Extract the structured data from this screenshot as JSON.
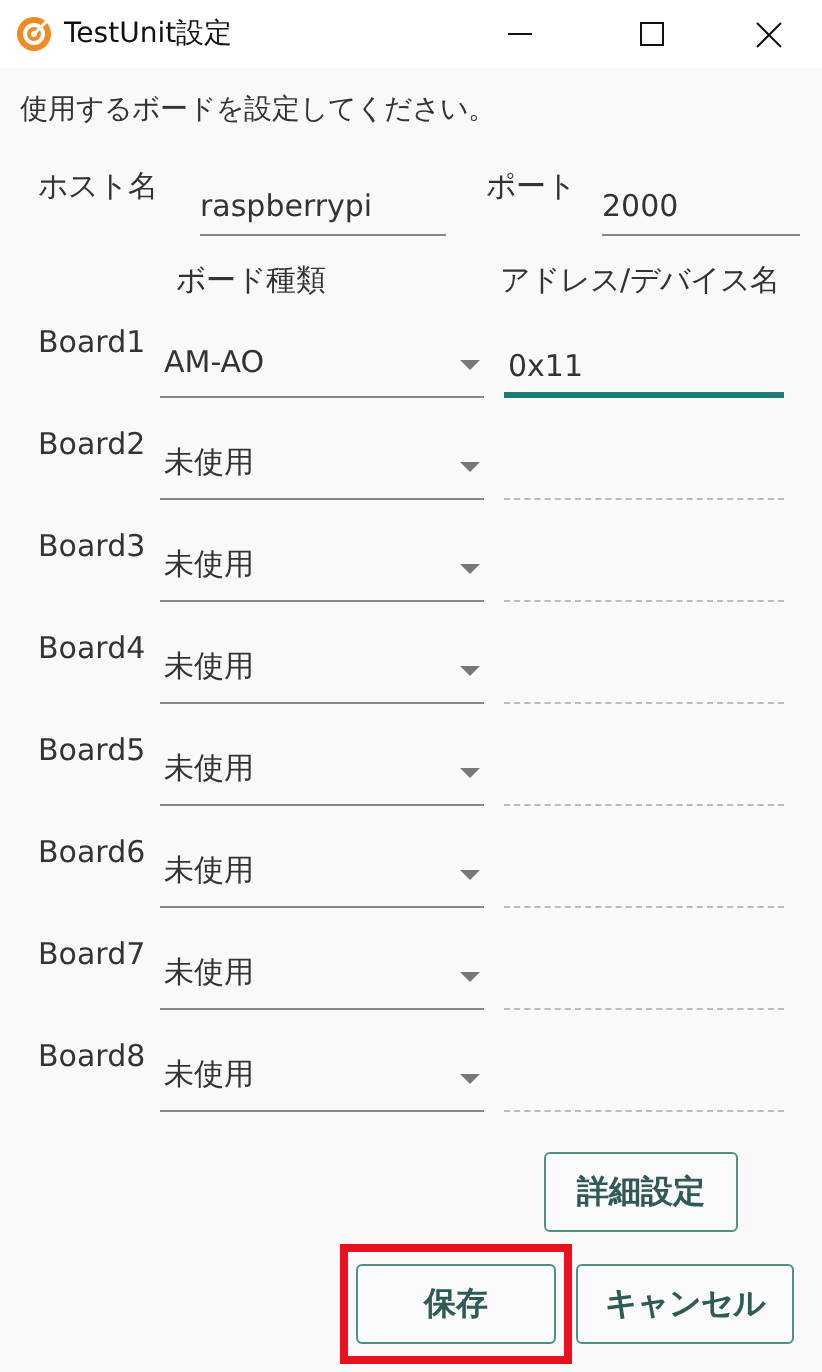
{
  "window": {
    "title": "TestUnit設定"
  },
  "instruction": "使用するボードを設定してください。",
  "host": {
    "label": "ホスト名",
    "value": "raspberrypi"
  },
  "port": {
    "label": "ポート",
    "value": "2000"
  },
  "columns": {
    "board_type": "ボード種類",
    "address": "アドレス/デバイス名"
  },
  "boards": [
    {
      "label": "Board1",
      "type": "AM-AO",
      "address": "0x11",
      "address_disabled": false,
      "address_focused": true
    },
    {
      "label": "Board2",
      "type": "未使用",
      "address_disabled": true,
      "address_focused": false
    },
    {
      "label": "Board3",
      "type": "未使用",
      "address_disabled": true,
      "address_focused": false
    },
    {
      "label": "Board4",
      "type": "未使用",
      "address_disabled": true,
      "address_focused": false
    },
    {
      "label": "Board5",
      "type": "未使用",
      "address_disabled": true,
      "address_focused": false
    },
    {
      "label": "Board6",
      "type": "未使用",
      "address_disabled": true,
      "address_focused": false
    },
    {
      "label": "Board7",
      "type": "未使用",
      "address_disabled": true,
      "address_focused": false
    },
    {
      "label": "Board8",
      "type": "未使用",
      "address_disabled": true,
      "address_focused": false
    }
  ],
  "buttons": [
    {
      "label": "詳細設定",
      "kind": "advanced",
      "highlighted": false
    },
    {
      "label": "保存",
      "kind": "save",
      "highlighted": true
    },
    {
      "label": "キャンセル",
      "kind": "cancel",
      "highlighted": false
    }
  ]
}
